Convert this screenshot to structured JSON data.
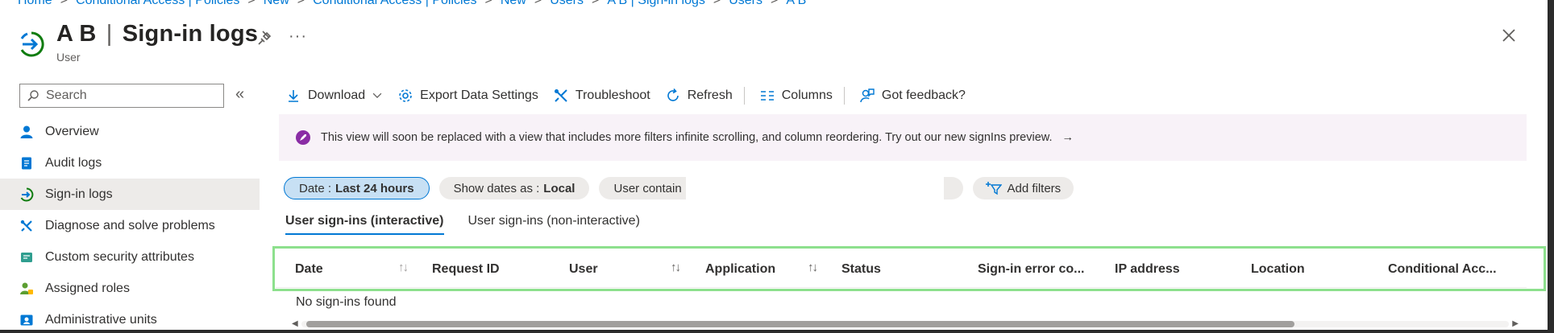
{
  "breadcrumb": [
    "Home",
    "Conditional Access | Policies",
    "New",
    "Conditional Access | Policies",
    "New",
    "Users",
    "A B | Sign-in logs",
    "Users",
    "A B"
  ],
  "header": {
    "title_name": "A B",
    "title_separator": "|",
    "title_page": "Sign-in logs",
    "subtitle": "User",
    "more_label": "···"
  },
  "sidebar": {
    "search_placeholder": "Search",
    "collapse_label": "«",
    "items": [
      {
        "label": "Overview",
        "icon": "user-icon"
      },
      {
        "label": "Audit logs",
        "icon": "audit-log-icon"
      },
      {
        "label": "Sign-in logs",
        "icon": "sign-in-icon",
        "active": true
      },
      {
        "label": "Diagnose and solve problems",
        "icon": "wrench-icon"
      },
      {
        "label": "Custom security attributes",
        "icon": "security-attributes-icon"
      },
      {
        "label": "Assigned roles",
        "icon": "roles-icon"
      },
      {
        "label": "Administrative units",
        "icon": "admin-units-icon"
      }
    ]
  },
  "toolbar": {
    "download": "Download",
    "export": "Export Data Settings",
    "troubleshoot": "Troubleshoot",
    "refresh": "Refresh",
    "columns": "Columns",
    "feedback": "Got feedback?"
  },
  "banner": {
    "text": "This view will soon be replaced with a view that includes more filters infinite scrolling, and column reordering. Try out our new signIns preview.",
    "arrow": "→"
  },
  "filters": {
    "date_label": "Date :",
    "date_value": "Last 24 hours",
    "show_dates_label": "Show dates as :",
    "show_dates_value": "Local",
    "user_filter": "User contain",
    "add_filters": "Add filters"
  },
  "tabs": [
    "User sign-ins (interactive)",
    "User sign-ins (non-interactive)"
  ],
  "table": {
    "columns": [
      "Date",
      "Request ID",
      "User",
      "Application",
      "Status",
      "Sign-in error co...",
      "IP address",
      "Location",
      "Conditional Acc..."
    ],
    "sort_glyph": "↑↓",
    "empty_text": "No sign-ins found"
  },
  "colors": {
    "accent": "#0078d4",
    "banner_bg": "#f8f2f8",
    "highlight": "#8de08d",
    "active_nav": "#edebe9"
  }
}
